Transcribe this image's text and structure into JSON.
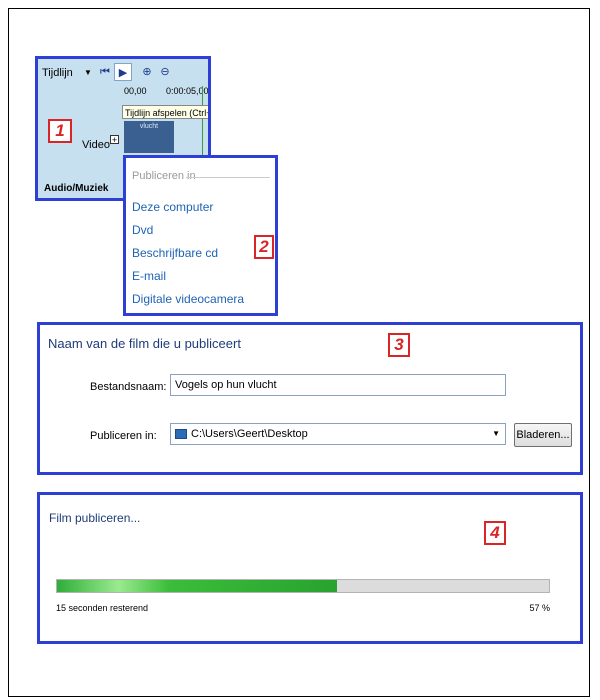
{
  "panel1": {
    "number": "1",
    "timeline_label": "Tijdlijn",
    "ruler_start": "00,00",
    "ruler_end": "0:00:05,00",
    "tooltip": "Tijdlijn afspelen (Ctrl+",
    "video_label": "Video",
    "clip_label": "vlucht",
    "audio_label": "Audio/Muziek"
  },
  "panel2": {
    "number": "2",
    "header": "Publiceren in",
    "items": [
      "Deze computer",
      "Dvd",
      "Beschrijfbare cd",
      "E-mail",
      "Digitale videocamera"
    ]
  },
  "panel3": {
    "number": "3",
    "title": "Naam van de film die u publiceert",
    "filename_label": "Bestandsnaam:",
    "filename_value": "Vogels op hun vlucht",
    "publish_label": "Publiceren in:",
    "publish_value": "C:\\Users\\Geert\\Desktop",
    "browse_label": "Bladeren..."
  },
  "panel4": {
    "number": "4",
    "title": "Film publiceren...",
    "progress": 0.57,
    "remaining": "15 seconden resterend",
    "percent": "57 %"
  },
  "colors": {
    "panel_border": "#2e3fd6",
    "number_red": "#d92525",
    "link_blue": "#1e64b4",
    "progress_green": "#2fae38"
  }
}
